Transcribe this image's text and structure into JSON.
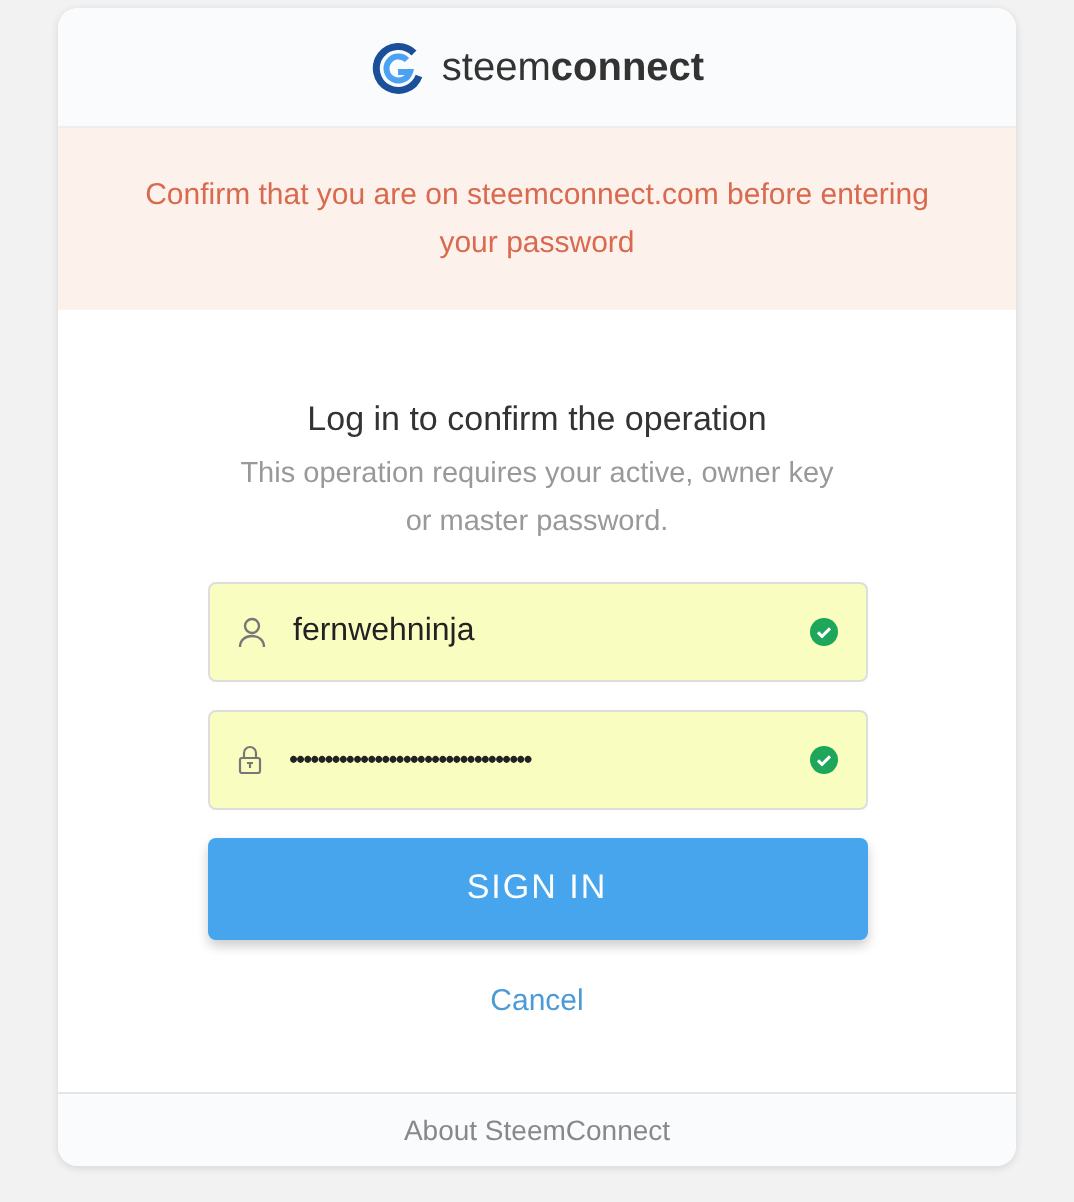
{
  "logo": {
    "text": "steem**connect**"
  },
  "warning": {
    "text": "Confirm that you are on steemconnect.com before entering your password"
  },
  "form": {
    "title": "Log in to confirm the operation",
    "subtitle": "This operation requires your active, owner key or master password.",
    "fields": [
      {
        "kind": "user",
        "value": "fernwehninja",
        "valid": true
      },
      {
        "kind": "password",
        "value": "••••••••••••••••••••••••••••••••••",
        "valid": true
      }
    ],
    "submit": "SIGN IN",
    "cancel": "Cancel"
  },
  "footer": {
    "link": "About SteemConnect"
  }
}
